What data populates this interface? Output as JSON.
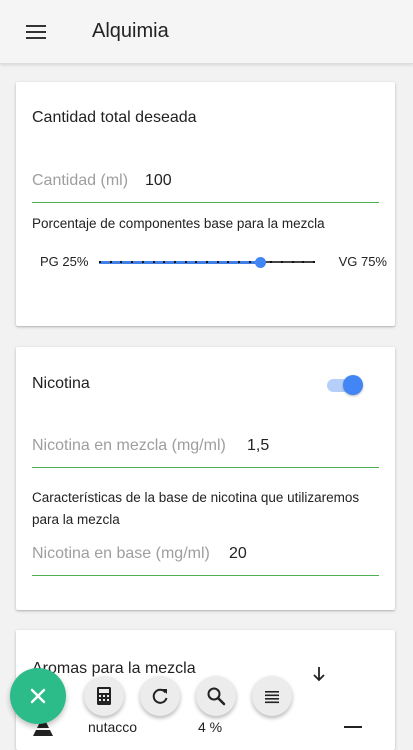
{
  "app": {
    "title": "Alquimia"
  },
  "total": {
    "title": "Cantidad total deseada",
    "field_label": "Cantidad (ml)",
    "field_value": "100",
    "mix_help": "Porcentaje de componentes base para la mezcla",
    "pg_label": "PG 25%",
    "vg_label": "VG 75%",
    "vg_percent": 75
  },
  "nicotine": {
    "title": "Nicotina",
    "toggle_on": true,
    "mix_label": "Nicotina en mezcla (mg/ml)",
    "mix_value": "1,5",
    "base_help": "Características de la base de nicotina que utilizaremos para la mezcla",
    "base_label": "Nicotina en base (mg/ml)",
    "base_value": "20"
  },
  "aromas": {
    "title": "Aromas para la mezcla",
    "items": [
      {
        "name": "nutacco",
        "percent": "4 %"
      }
    ]
  },
  "colors": {
    "accent": "#4285f4",
    "fab": "#2bbc8a",
    "underline": "#4caf50"
  },
  "toolbar": {
    "fab_icon": "close-icon",
    "actions": [
      "calculator-icon",
      "refresh-icon",
      "search-icon",
      "list-icon"
    ]
  }
}
